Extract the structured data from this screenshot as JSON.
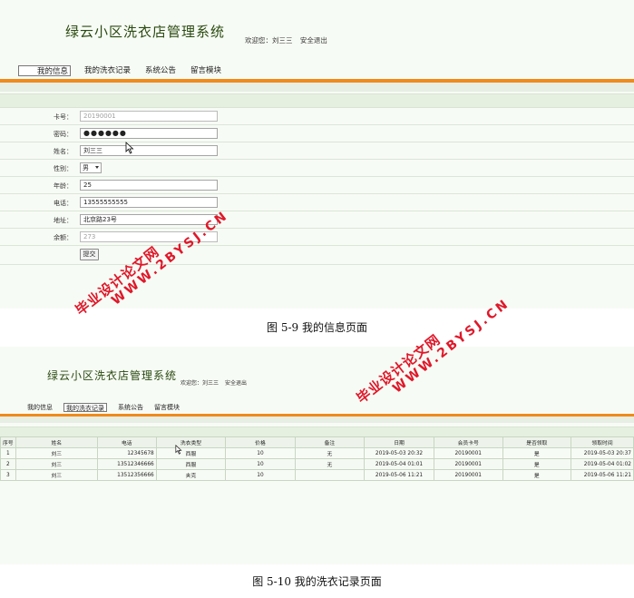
{
  "screen1": {
    "system_title": "绿云小区洗衣店管理系统",
    "welcome": "欢迎您：刘三三",
    "logout": "安全退出",
    "nav": [
      "我的信息",
      "我的洗衣记录",
      "系统公告",
      "留言模块"
    ],
    "active_nav": "我的信息",
    "form": {
      "card_label": "卡号：",
      "card_value": "20190001",
      "password_label": "密码：",
      "password_value": "●●●●●●",
      "name_label": "姓名：",
      "name_value": "刘三三",
      "gender_label": "性别：",
      "gender_value": "男",
      "age_label": "年龄：",
      "age_value": "25",
      "phone_label": "电话：",
      "phone_value": "13555555555",
      "address_label": "地址：",
      "address_value": "北京路23号",
      "balance_label": "余额：",
      "balance_value": "273",
      "submit_label": "提交"
    }
  },
  "caption1": "图 5-9 我的信息页面",
  "screen2": {
    "system_title": "绿云小区洗衣店管理系统",
    "welcome": "欢迎您：刘三三",
    "logout": "安全退出",
    "nav": [
      "我的信息",
      "我的洗衣记录",
      "系统公告",
      "留言模块"
    ],
    "active_nav": "我的洗衣记录",
    "table": {
      "headers": [
        "序号",
        "姓名",
        "电话",
        "洗衣类型",
        "价格",
        "备注",
        "日期",
        "会员卡号",
        "是否领取",
        "领取时间"
      ],
      "rows": [
        [
          "1",
          "刘三",
          "12345678",
          "西服",
          "10",
          "无",
          "2019-05-03 20:32",
          "20190001",
          "是",
          "2019-05-03 20:37"
        ],
        [
          "2",
          "刘三",
          "13512346666",
          "西服",
          "10",
          "无",
          "2019-05-04 01:01",
          "20190001",
          "是",
          "2019-05-04 01:02"
        ],
        [
          "3",
          "刘三",
          "13512356666",
          "夹克",
          "10",
          "",
          "2019-05-06 11:21",
          "20190001",
          "是",
          "2019-05-06 11:21"
        ]
      ]
    }
  },
  "caption2": "图 5-10 我的洗衣记录页面",
  "watermark": {
    "text_cn": "毕业设计论文网",
    "text_url": "WWW.2BYSJ.CN",
    "color": "#e0182a"
  }
}
